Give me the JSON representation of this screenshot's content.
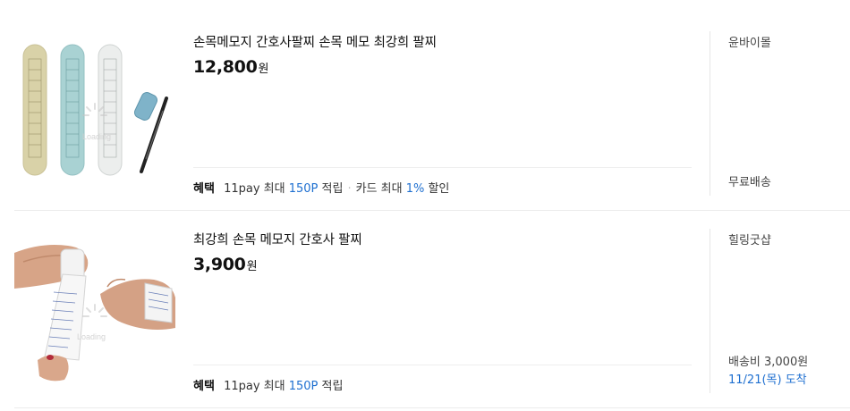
{
  "products": [
    {
      "title": "손목메모지 간호사팔찌 손목 메모 최강희 팔찌",
      "price": "12,800",
      "price_unit": "원",
      "benefit_label": "혜택",
      "benefit_text1": "11pay 최대",
      "benefit_points": "150P",
      "benefit_text2": "적립",
      "benefit_card": "카드 최대",
      "benefit_percent": "1%",
      "benefit_text3": "할인",
      "seller": "윤바이몰",
      "shipping": "무료배송",
      "image_loading_text": "Loading"
    },
    {
      "title": "최강희 손목 메모지 간호사 팔찌",
      "price": "3,900",
      "price_unit": "원",
      "benefit_label": "혜택",
      "benefit_text1": "11pay 최대",
      "benefit_points": "150P",
      "benefit_text2": "적립",
      "seller": "힐링굿샵",
      "shipping_fee": "배송비 3,000원",
      "delivery": "11/21(목) 도착",
      "image_loading_text": "Loading"
    }
  ],
  "colors": {
    "accent_blue": "#1e6fd0",
    "divider": "#ececec"
  }
}
